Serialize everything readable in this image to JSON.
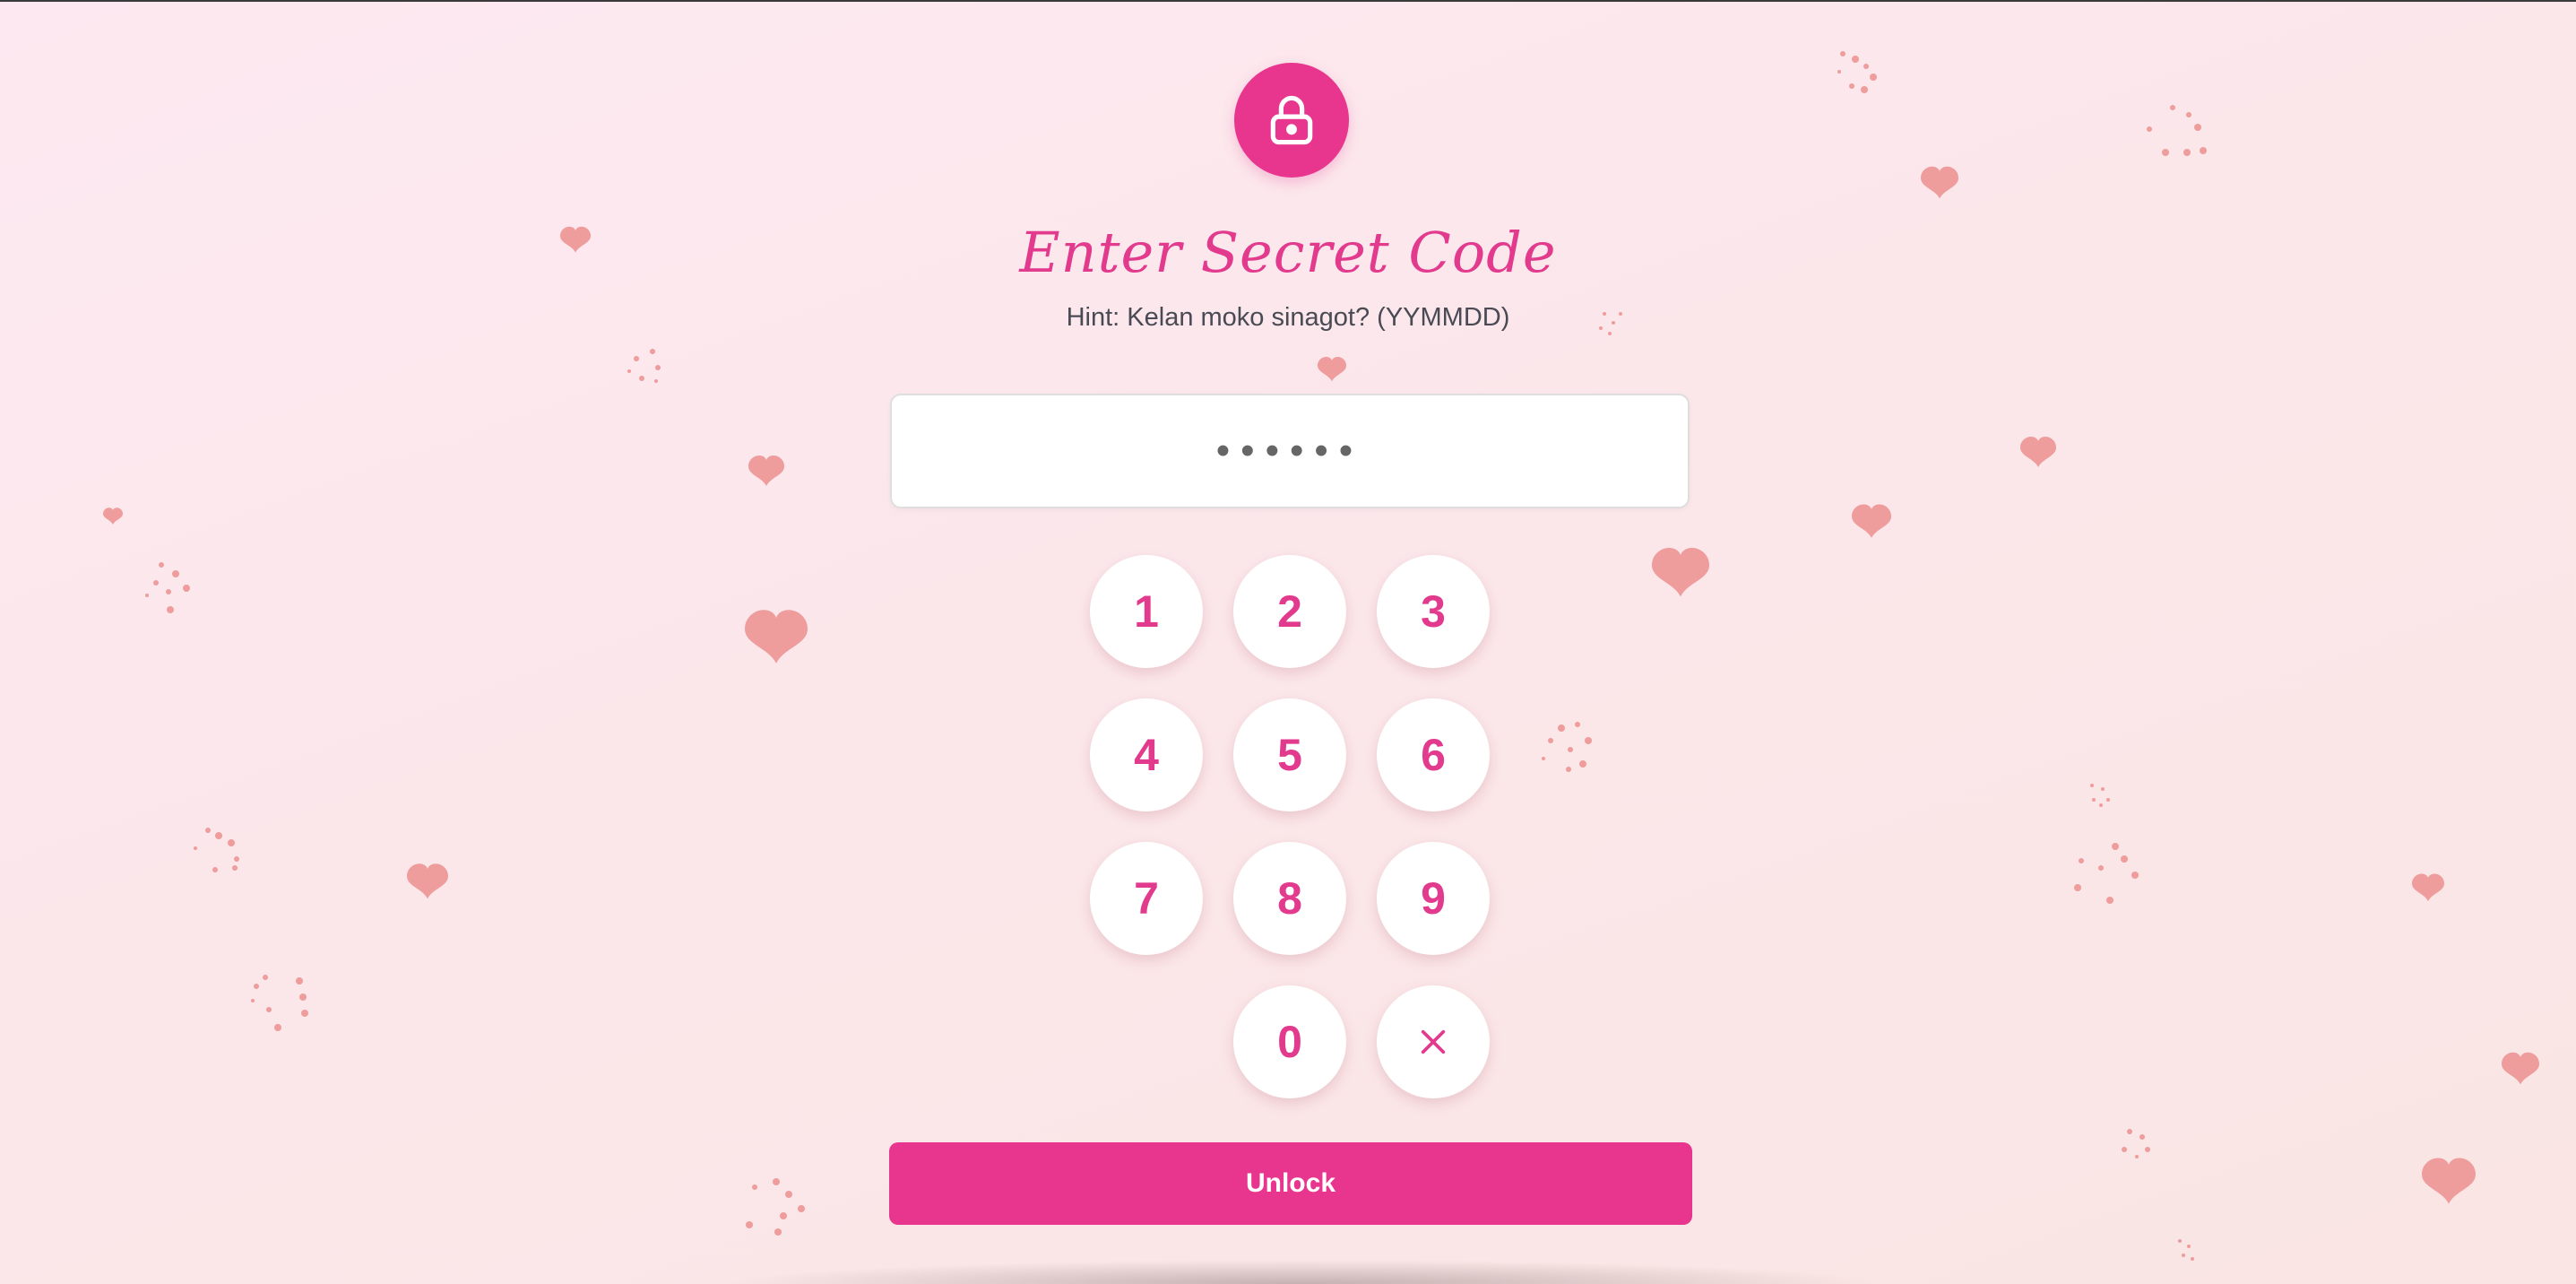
{
  "header": {
    "lock_icon": "lock-icon",
    "title": "Enter Secret Code",
    "hint": "Hint: Kelan moko sinagot? (YYMMDD)"
  },
  "code_input": {
    "masked_value": "••••••",
    "digits_entered": 6
  },
  "keypad": {
    "keys": [
      "1",
      "2",
      "3",
      "4",
      "5",
      "6",
      "7",
      "8",
      "9",
      "0"
    ],
    "clear_icon": "close-icon",
    "clear_label": "×"
  },
  "actions": {
    "unlock_label": "Unlock"
  },
  "colors": {
    "accent": "#e8368f",
    "title_pink": "#e23a8d",
    "heart": "#ee9c9c",
    "background": "#fbe7ec"
  },
  "decorations": {
    "heart_icon": "heart-icon",
    "sparkle_icon": "sparkle-dots"
  }
}
